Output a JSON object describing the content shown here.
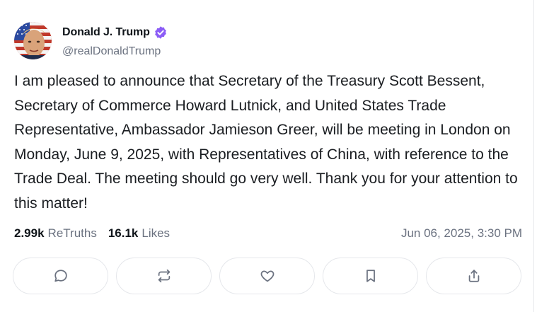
{
  "post": {
    "author": {
      "display_name": "Donald J. Trump",
      "handle": "@realDonaldTrump",
      "verified": true,
      "verified_color": "#8b5cf6"
    },
    "text": "I am pleased to announce that Secretary of the Treasury Scott Bessent, Secretary of Commerce Howard Lutnick, and United States Trade Representative, Ambassador Jamieson Greer, will be meeting in London on Monday, June 9, 2025, with Representatives of China, with reference to the Trade Deal. The meeting should go very well. Thank you for your attention to this matter!",
    "stats": {
      "retruths_count": "2.99k",
      "retruths_label": "ReTruths",
      "likes_count": "16.1k",
      "likes_label": "Likes"
    },
    "timestamp": "Jun 06, 2025, 3:30 PM",
    "actions": [
      {
        "icon": "reply-icon"
      },
      {
        "icon": "retruth-icon"
      },
      {
        "icon": "heart-icon"
      },
      {
        "icon": "bookmark-icon"
      },
      {
        "icon": "share-icon"
      }
    ]
  }
}
